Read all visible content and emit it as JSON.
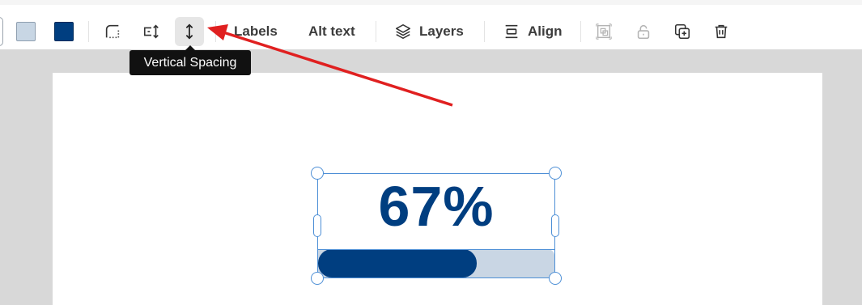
{
  "toolbar": {
    "swatches": [
      {
        "name": "light-fill",
        "color": "#c8d6e4"
      },
      {
        "name": "dark-fill",
        "color": "#003e80"
      }
    ],
    "icons": {
      "border_style": "dotted-corner-icon",
      "horizontal_spacing": "horizontal-spacing-icon",
      "vertical_spacing": "vertical-spacing-icon",
      "layers": "layers-icon",
      "align": "align-icon",
      "group": "group-icon",
      "lock": "unlock-icon",
      "duplicate": "duplicate-icon",
      "delete": "trash-icon"
    },
    "labels_label": "Labels",
    "alt_text_label": "Alt text",
    "layers_label": "Layers",
    "align_label": "Align"
  },
  "tooltip": {
    "text": "Vertical Spacing"
  },
  "canvas": {
    "value_text": "67%",
    "progress": 0.67,
    "colors": {
      "accent": "#003e80",
      "track": "#c9d6e4",
      "selection": "#4d8fd6",
      "annotation_arrow": "#e02020"
    }
  }
}
